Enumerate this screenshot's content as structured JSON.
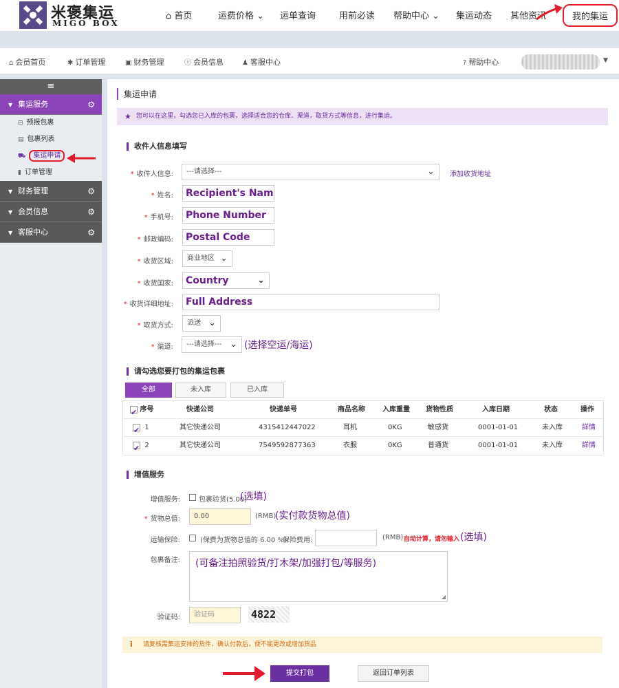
{
  "brand": {
    "name_cn": "米褒集运",
    "name_en": "MIGO BOX"
  },
  "topnav": {
    "items": [
      "首页",
      "运费价格",
      "运单查询",
      "用前必读",
      "帮助中心",
      "集运动态",
      "其他资讯",
      "我的集运"
    ]
  },
  "subnav": {
    "items": [
      "会员首页",
      "订单管理",
      "财务管理",
      "会员信息",
      "客服中心"
    ],
    "help": "帮助中心"
  },
  "sidebar": {
    "toggle_icon": "≡",
    "groups": [
      {
        "label": "集运服务",
        "items": [
          "预报包裹",
          "包裹列表",
          "集运申请",
          "订单管理"
        ]
      },
      {
        "label": "财务管理"
      },
      {
        "label": "会员信息"
      },
      {
        "label": "客服中心"
      }
    ]
  },
  "page": {
    "title": "集运申请",
    "notice": "您可以在这里，勾选您已入库的包裹，选择适合您的仓库、渠道，取货方式等信息，进行集运。"
  },
  "recipient": {
    "section_title": "收件人信息填写",
    "labels": {
      "info": "收件人信息:",
      "name": "姓名:",
      "phone": "手机号:",
      "postal": "邮政编码:",
      "area": "收货区域:",
      "country": "收货国家:",
      "address": "收货详细地址:",
      "pickup": "取货方式:",
      "channel": "渠道:"
    },
    "info_select": "---请选择---",
    "add_address": "添加收货地址",
    "name_value": "Recipient's Name",
    "phone_value": "Phone Number",
    "postal_value": "Postal Code",
    "area_value": "商业地区",
    "country_value": "Country",
    "address_value": "Full Address",
    "pickup_value": "派送",
    "channel_value": "---请选择---",
    "channel_note": "(选择空运/海运)"
  },
  "packages": {
    "section_title": "请勾选您要打包的集运包裹",
    "tabs": [
      "全部",
      "未入库",
      "已入库"
    ],
    "columns": [
      "序号",
      "快递公司",
      "快递单号",
      "商品名称",
      "入库重量",
      "货物性质",
      "入库日期",
      "状态",
      "操作"
    ],
    "rows": [
      {
        "no": "1",
        "company": "其它快递公司",
        "tracking": "4315412447022",
        "name": "耳机",
        "weight": "0KG",
        "nature": "敏感货",
        "date": "0001-01-01",
        "status": "未入库",
        "action": "詳情"
      },
      {
        "no": "2",
        "company": "其它快递公司",
        "tracking": "7549592877363",
        "name": "衣服",
        "weight": "0KG",
        "nature": "普通货",
        "date": "0001-01-01",
        "status": "未入库",
        "action": "詳情"
      }
    ]
  },
  "value_added": {
    "section_title": "增值服务",
    "service_label": "增值服务:",
    "service_option": "包裹验货(5.00)",
    "service_note": "(选填)",
    "total_label": "货物总值:",
    "total_value": "0.00",
    "rmb": "(RMB)",
    "total_note": "(实付款货物总值)",
    "insurance_label": "运输保险:",
    "insurance_option": "(保费为货物总值的 6.00 %)",
    "insurance_fee_label": "保险费用:",
    "rmb2": "(RMB)",
    "auto_calc": "自动计算，请勿输入",
    "insurance_note": "(选填)",
    "remark_label": "包裹备注:",
    "remark_value": "(可备注拍照验货/打木架/加强打包/等服务)",
    "captcha_label": "验证码:",
    "captcha_placeholder": "验证码",
    "captcha_code": "4822"
  },
  "warning": "请复核需集运安排的货件，确认付款后，便不能更改或增加货品",
  "buttons": {
    "submit": "提交打包",
    "back": "返回订单列表"
  },
  "colors": {
    "brand_purple": "#8a44b8",
    "annotation_red": "#e21c2a"
  }
}
